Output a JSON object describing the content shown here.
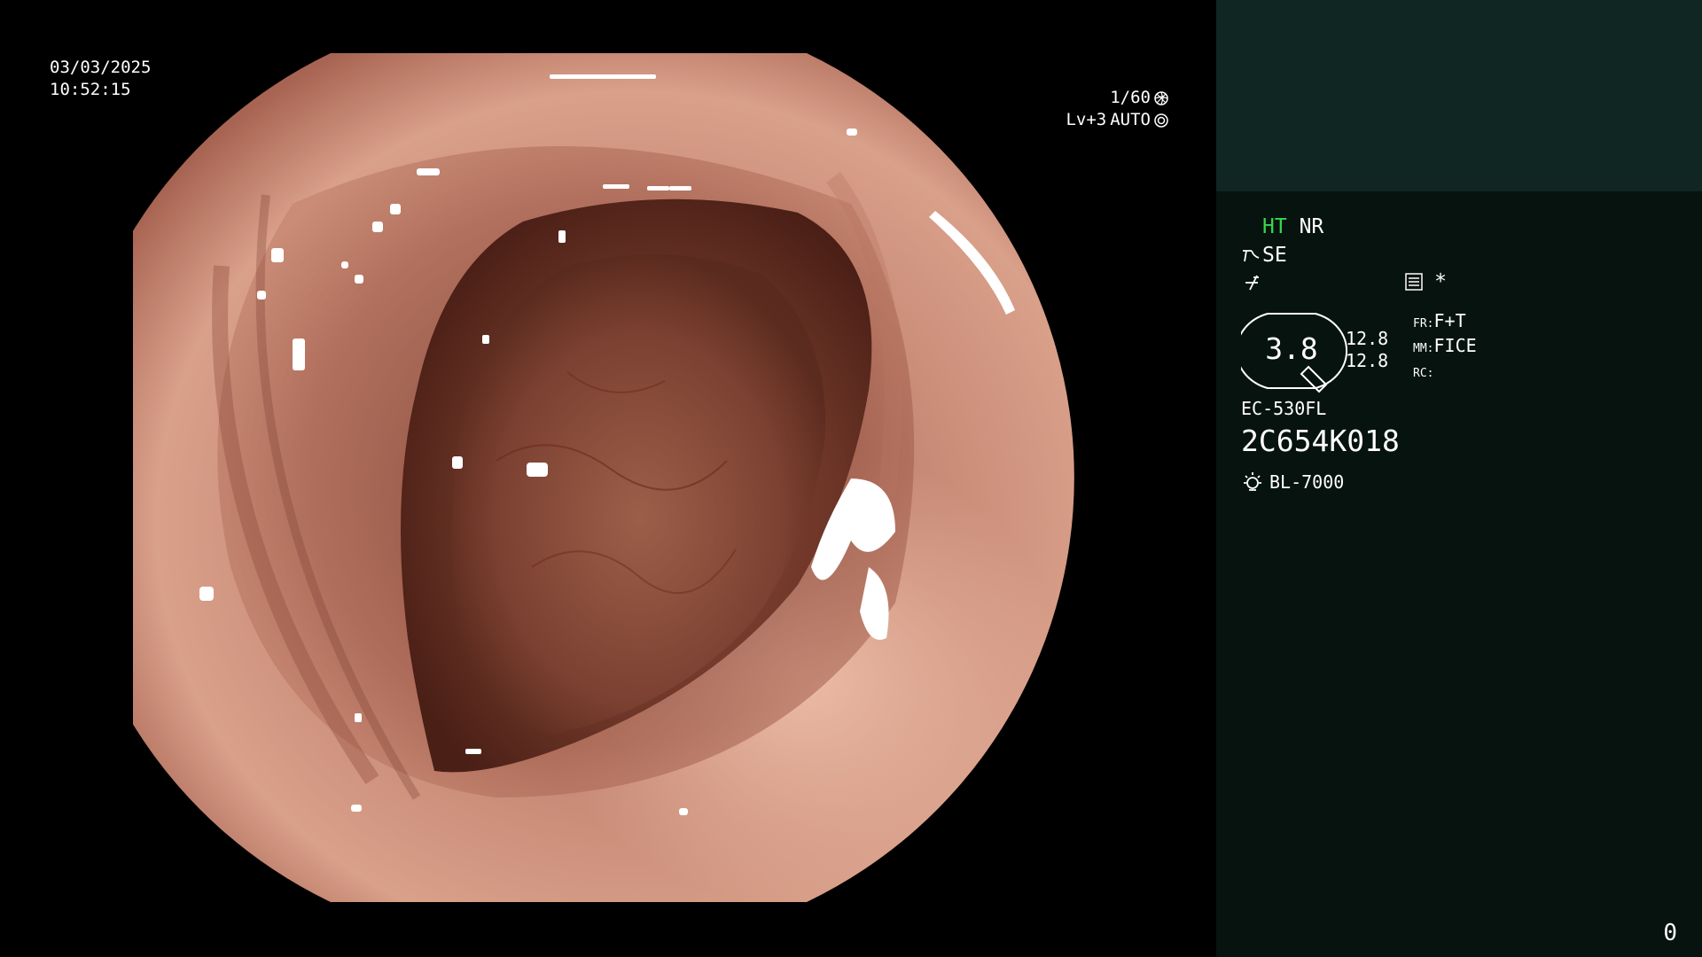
{
  "datetime": {
    "date": "03/03/2025",
    "time": "10:52:15"
  },
  "exposure": {
    "shutter": "1/60",
    "level": "Lv+3",
    "mode": "AUTO"
  },
  "panel": {
    "mode_ht": "HT",
    "mode_nr": "NR",
    "se_label": "SE",
    "star": "*",
    "gauge_value": "3.8",
    "gauge_num_top": "12.8",
    "gauge_num_bottom": "12.8",
    "fr_label": "FR:",
    "fr_value": "F+T",
    "mm_label": "MM:",
    "mm_value": "FICE",
    "rc_label": "RC:",
    "scope_model": "EC-530FL",
    "scope_serial": "2C654K018",
    "light_source": "BL-7000"
  },
  "page_counter": "0",
  "colors": {
    "panel_bg": "#06130f",
    "panel_top_bg": "#0f2622",
    "ht_green": "#36d94b",
    "background": "#000000"
  },
  "icons": [
    "shutter-icon",
    "iris-icon",
    "enhance-icon",
    "tone-icon",
    "menu-list-icon",
    "lamp-icon"
  ]
}
